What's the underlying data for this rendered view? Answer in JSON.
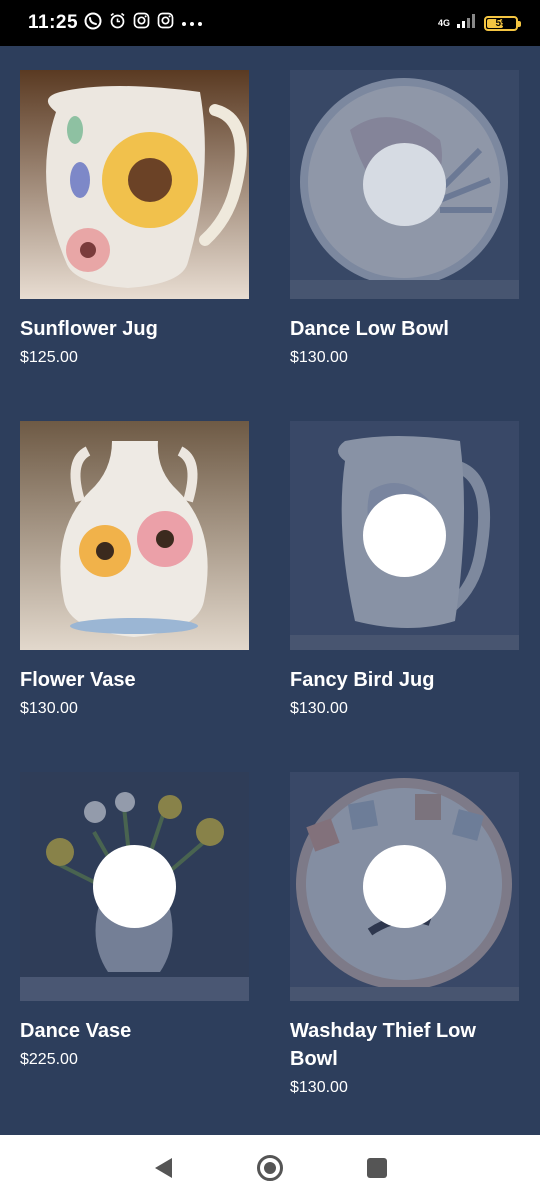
{
  "status_bar": {
    "time": "11:25",
    "network": "4G",
    "battery": "59",
    "battery_level": 0.59,
    "icons": [
      "whatsapp-icon",
      "alarm-icon",
      "instagram-icon",
      "instagram-icon",
      "more-dots-icon",
      "signal-icon",
      "battery-icon"
    ]
  },
  "products": [
    {
      "title": "Sunflower Jug",
      "price": "$125.00"
    },
    {
      "title": "Dance Low Bowl",
      "price": "$130.00"
    },
    {
      "title": "Flower Vase",
      "price": "$130.00"
    },
    {
      "title": "Fancy Bird Jug",
      "price": "$130.00"
    },
    {
      "title": "Dance Vase",
      "price": "$225.00"
    },
    {
      "title": "Washday Thief Low Bowl",
      "price": "$130.00"
    }
  ],
  "nav_bar": {
    "icons": [
      "back-icon",
      "home-icon",
      "recents-icon"
    ]
  },
  "colors": {
    "background": "#2d3e5c",
    "status_bar": "#000000",
    "nav_bar": "#ffffff",
    "battery": "#f4c542"
  }
}
